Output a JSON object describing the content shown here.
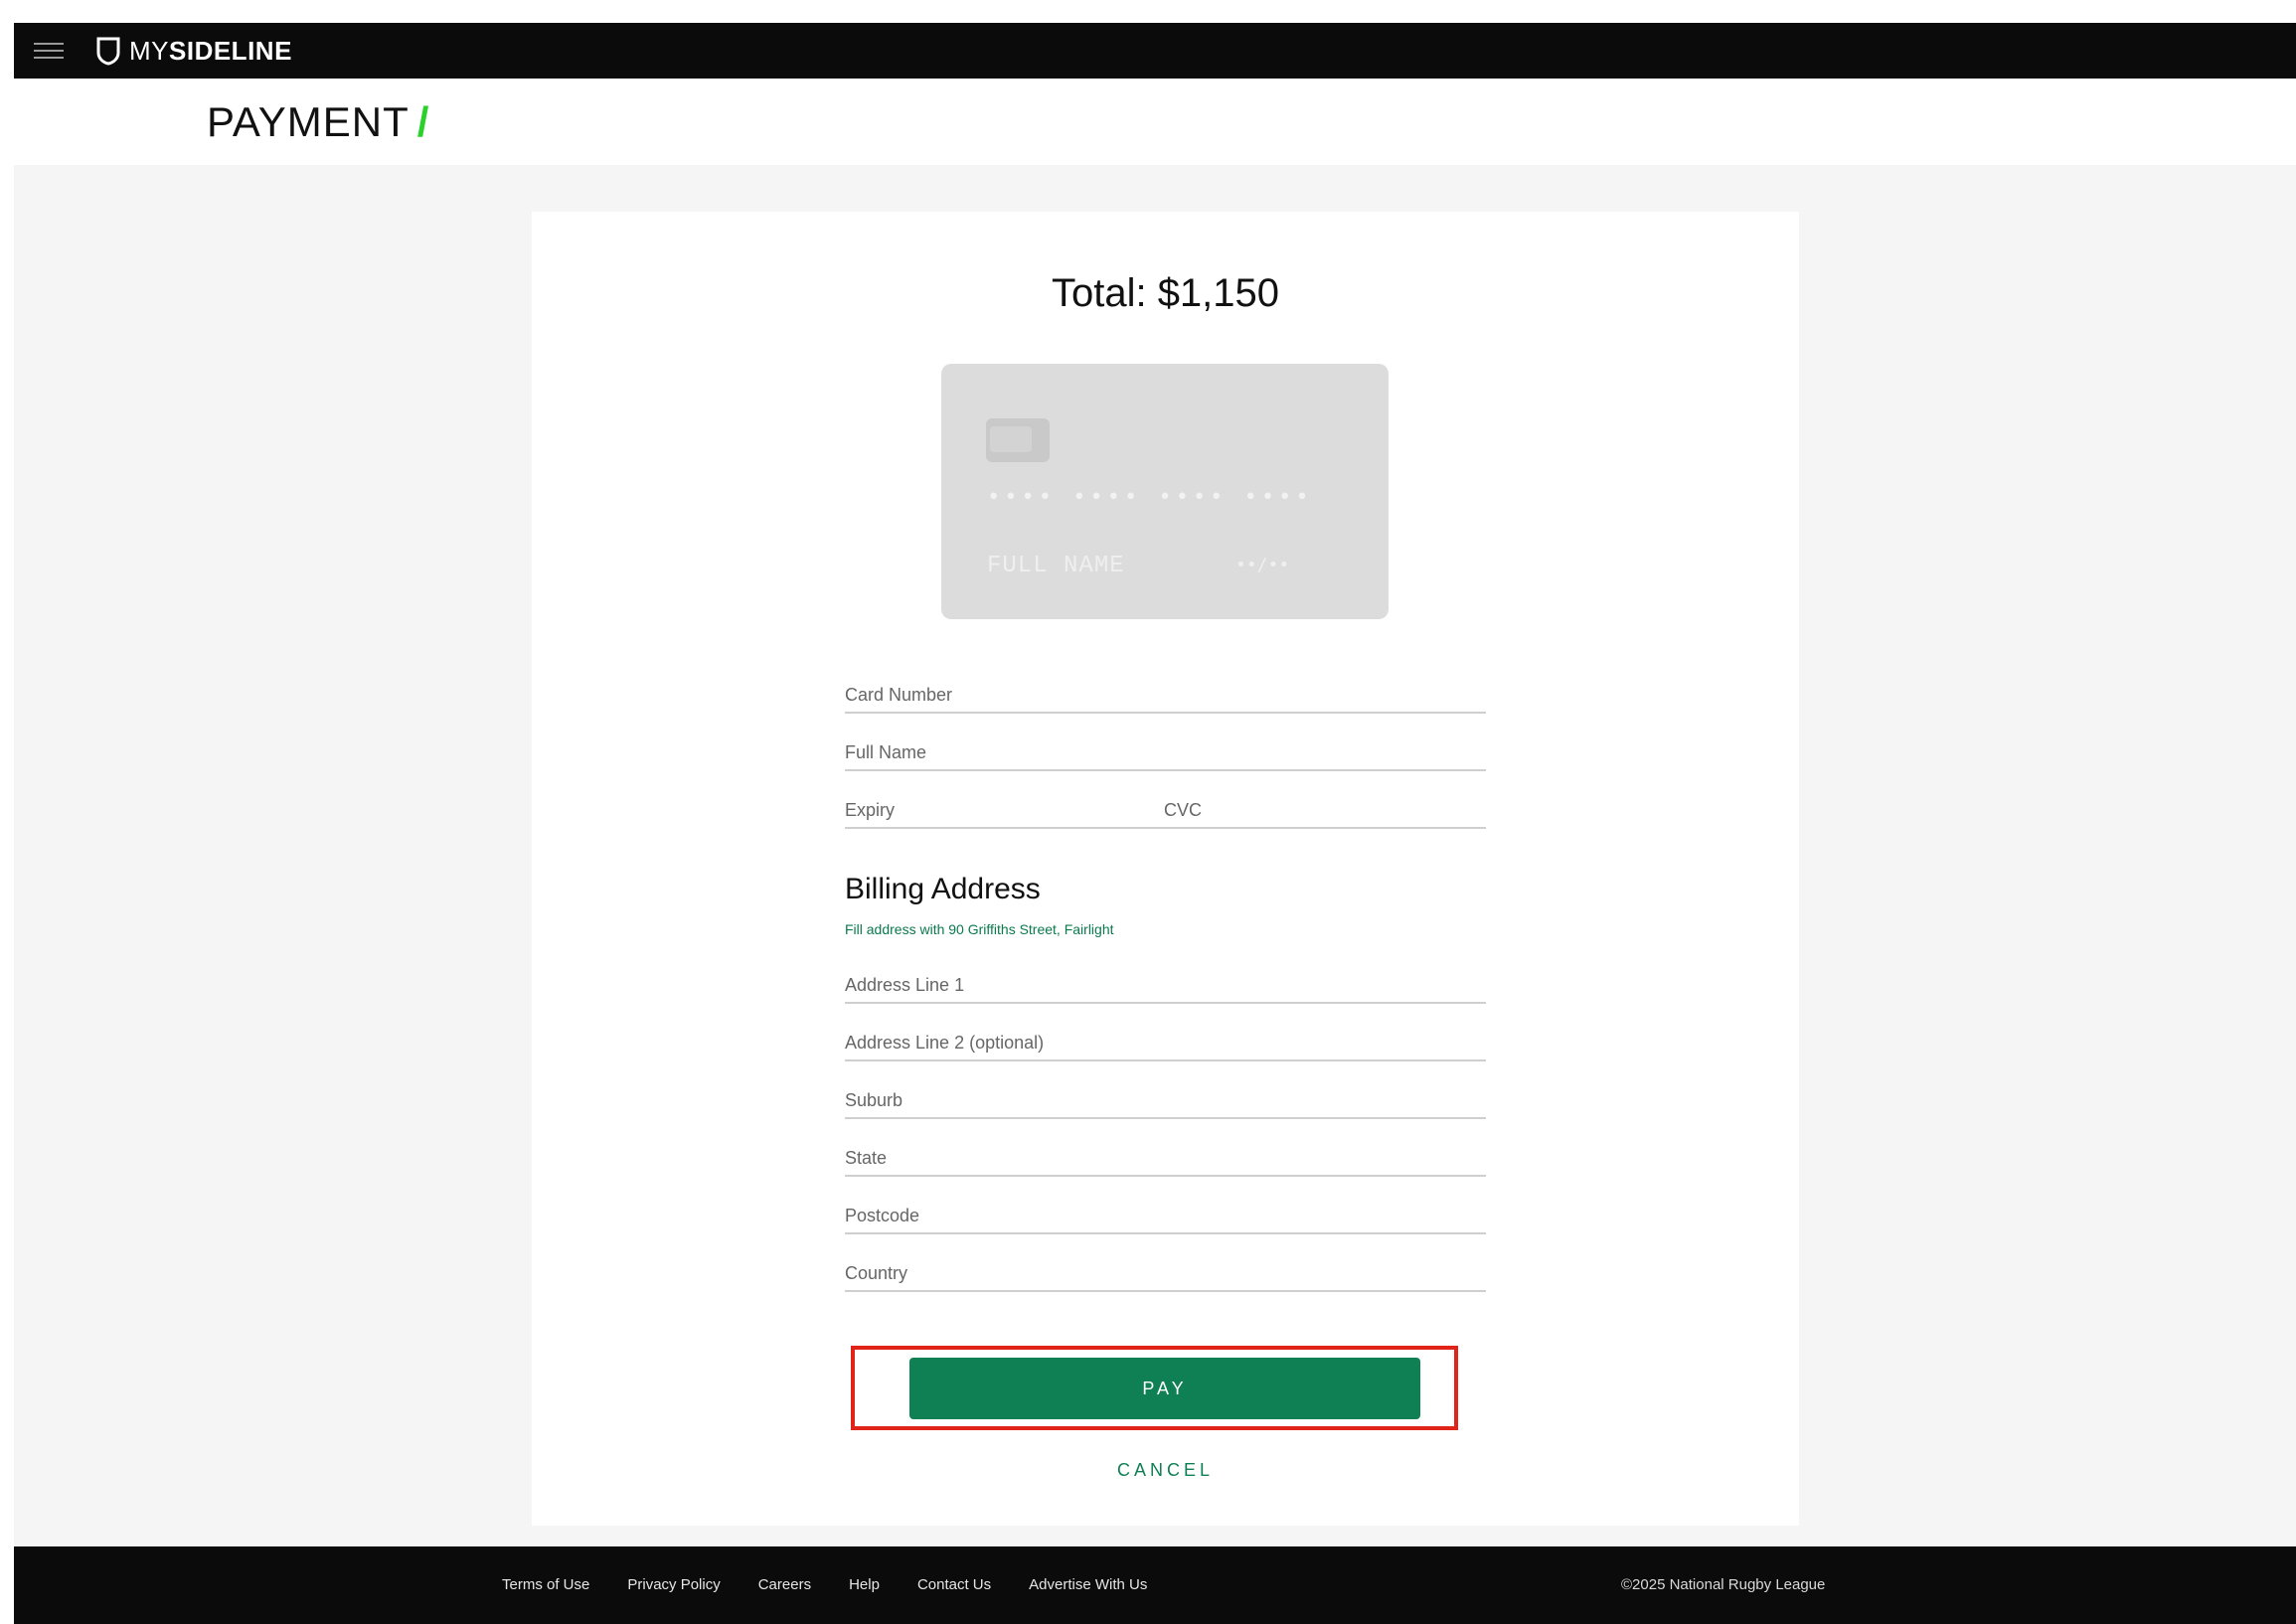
{
  "app": {
    "brand_light": "MY",
    "brand_bold": "SIDELINE"
  },
  "header": {
    "title": "PAYMENT",
    "title_slash": "/",
    "accent_color": "#2bd12b"
  },
  "payment": {
    "total_label": "Total: $1,150",
    "card_preview": {
      "number_mask": "•••• •••• •••• ••••",
      "name_placeholder": "FULL NAME",
      "expiry_mask": "••/••"
    },
    "fields": {
      "card_number": "Card Number",
      "full_name": "Full Name",
      "expiry": "Expiry",
      "cvc": "CVC"
    },
    "billing": {
      "title": "Billing Address",
      "fill_link": "Fill address with 90 Griffiths Street, Fairlight",
      "address_line_1": "Address Line 1",
      "address_line_2": "Address Line 2 (optional)",
      "suburb": "Suburb",
      "state": "State",
      "postcode": "Postcode",
      "country": "Country"
    },
    "pay_label": "PAY",
    "cancel_label": "CANCEL",
    "button_color": "#0f7f54"
  },
  "footer": {
    "links": [
      "Terms of Use",
      "Privacy Policy",
      "Careers",
      "Help",
      "Contact Us",
      "Advertise With Us"
    ],
    "copyright": "©2025 National Rugby League"
  },
  "icons": {
    "menu": "hamburger-menu-icon",
    "logo": "shield-logo-icon",
    "chip": "card-chip-icon"
  }
}
